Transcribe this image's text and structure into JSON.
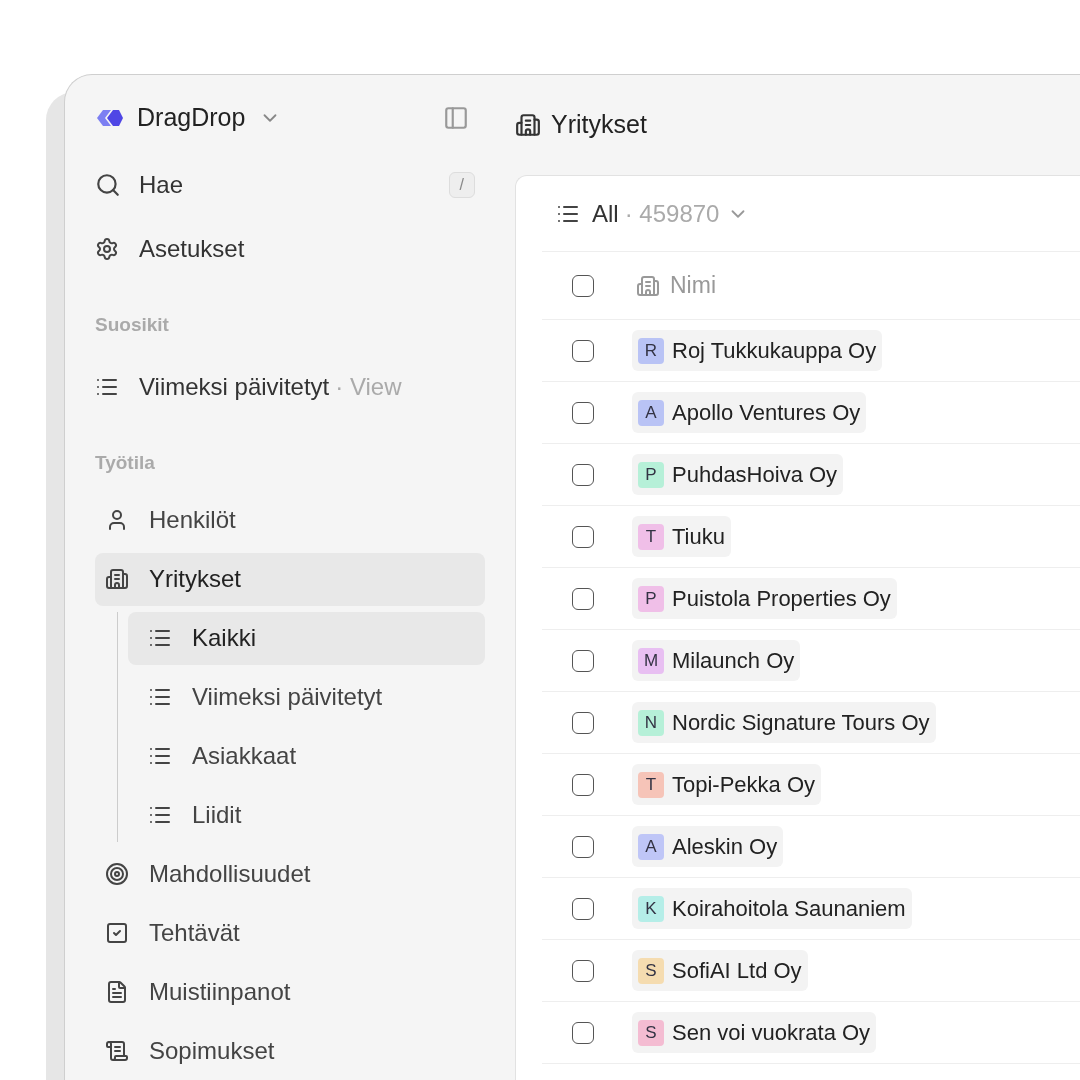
{
  "workspace": {
    "name": "DragDrop"
  },
  "page_title": "Yritykset",
  "sidebar": {
    "search": {
      "label": "Hae",
      "shortcut": "/"
    },
    "settings": {
      "label": "Asetukset"
    },
    "favorites": {
      "heading": "Suosikit",
      "items": [
        {
          "label": "Viimeksi päivitetyt",
          "suffix": "· View"
        }
      ]
    },
    "workspace_section": {
      "heading": "Työtila",
      "items": [
        {
          "label": "Henkilöt",
          "selected": false
        },
        {
          "label": "Yritykset",
          "selected": true,
          "expanded": true,
          "children": [
            {
              "label": "Kaikki",
              "selected": true
            },
            {
              "label": "Viimeksi päivitetyt",
              "selected": false
            },
            {
              "label": "Asiakkaat",
              "selected": false
            },
            {
              "label": "Liidit",
              "selected": false
            }
          ]
        },
        {
          "label": "Mahdollisuudet",
          "selected": false
        },
        {
          "label": "Tehtävät",
          "selected": false
        },
        {
          "label": "Muistiinpanot",
          "selected": false
        },
        {
          "label": "Sopimukset",
          "selected": false
        }
      ]
    }
  },
  "view": {
    "name": "All",
    "count": "· 459870"
  },
  "table": {
    "header": {
      "checked": false,
      "column": "Nimi"
    },
    "rows": [
      {
        "initial": "R",
        "name": "Roj Tukkukauppa Oy",
        "color": "#b9c3f5",
        "checked": false
      },
      {
        "initial": "A",
        "name": "Apollo Ventures Oy",
        "color": "#b9c3f5",
        "checked": false
      },
      {
        "initial": "P",
        "name": "PuhdasHoiva Oy",
        "color": "#b6f0d8",
        "checked": false
      },
      {
        "initial": "T",
        "name": "Tiuku",
        "color": "#f0bfe8",
        "checked": false
      },
      {
        "initial": "P",
        "name": "Puistola Properties Oy",
        "color": "#f0bfe8",
        "checked": false
      },
      {
        "initial": "M",
        "name": "Milaunch Oy",
        "color": "#e8bff2",
        "checked": false
      },
      {
        "initial": "N",
        "name": "Nordic Signature Tours Oy",
        "color": "#b6f0d8",
        "checked": false
      },
      {
        "initial": "T",
        "name": "Topi-Pekka Oy",
        "color": "#f6c4b8",
        "checked": false
      },
      {
        "initial": "A",
        "name": "Aleskin Oy",
        "color": "#bfc6f7",
        "checked": false
      },
      {
        "initial": "K",
        "name": "Koirahoitola Saunaniem",
        "color": "#b5eee8",
        "checked": false
      },
      {
        "initial": "S",
        "name": "SofiAI Ltd Oy",
        "color": "#f5dcb0",
        "checked": false
      },
      {
        "initial": "S",
        "name": "Sen voi vuokrata Oy",
        "color": "#f4bcd2",
        "checked": false
      }
    ]
  }
}
